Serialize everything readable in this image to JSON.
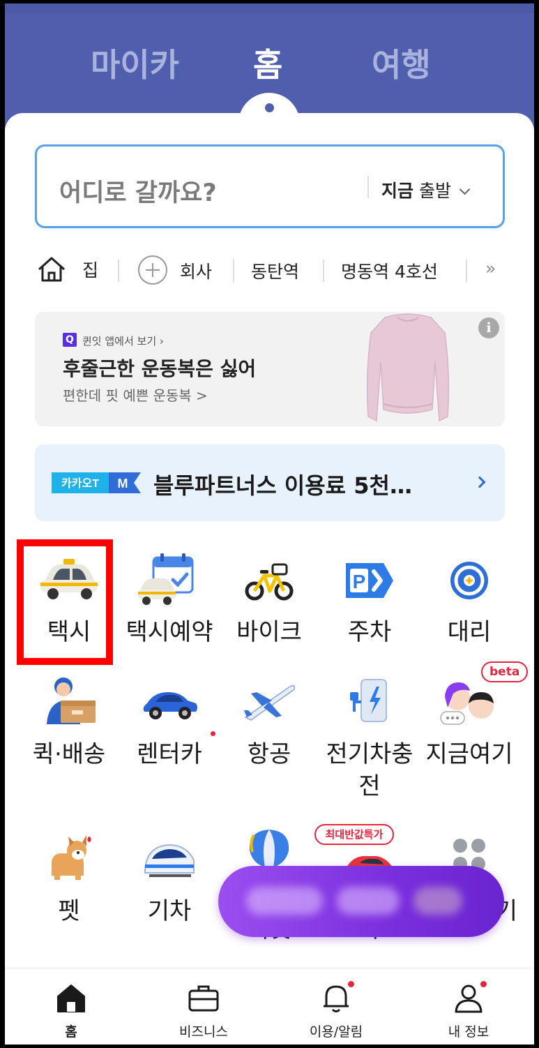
{
  "top_tabs": [
    {
      "label": "마이카",
      "active": false
    },
    {
      "label": "홈",
      "active": true
    },
    {
      "label": "여행",
      "active": false
    }
  ],
  "search": {
    "placeholder": "어디로 갈까요?",
    "depart_strong": "지금",
    "depart_rest": " 출발"
  },
  "shortcuts": [
    {
      "label": "집",
      "icon": "home-icon"
    },
    {
      "label": "회사",
      "icon": "plus-circle-icon"
    },
    {
      "label": "동탄역"
    },
    {
      "label": "명동역 4호선"
    }
  ],
  "more_glyph": "»",
  "ad": {
    "source": "퀸잇 앱에서 보기 ›",
    "source_logo": "Q",
    "title": "후줄근한 운동복은 싫어",
    "subtitle": "편한데 핏 예쁜 운동복 >",
    "info": "i"
  },
  "promo": {
    "badge_left": "카카오T",
    "badge_right": "M",
    "text": "블루파트너스 이용료 5천…"
  },
  "services": [
    {
      "label": "택시",
      "icon": "taxi-icon"
    },
    {
      "label": "택시예약",
      "icon": "taxi-reservation-icon"
    },
    {
      "label": "바이크",
      "icon": "bike-icon"
    },
    {
      "label": "주차",
      "icon": "parking-icon"
    },
    {
      "label": "대리",
      "icon": "steering-wheel-icon"
    },
    {
      "label": "퀵·배송",
      "icon": "delivery-icon"
    },
    {
      "label": "렌터카",
      "icon": "rental-car-icon",
      "dot": true
    },
    {
      "label": "항공",
      "icon": "airplane-icon"
    },
    {
      "label": "전기차충전",
      "icon": "ev-charging-icon"
    },
    {
      "label": "지금여기",
      "icon": "now-here-icon",
      "badge": "beta"
    },
    {
      "label": "펫",
      "icon": "pet-icon"
    },
    {
      "label": "기차",
      "icon": "train-icon"
    },
    {
      "label": "티켓",
      "icon": "balloon-icon"
    },
    {
      "label": "가",
      "icon": "sports-car-icon",
      "badge": "최대반값특가"
    },
    {
      "label": "기",
      "icon": "more-grid-icon"
    }
  ],
  "bottom_nav": [
    {
      "label": "홈",
      "icon": "home-filled-icon",
      "active": true
    },
    {
      "label": "비즈니스",
      "icon": "briefcase-icon"
    },
    {
      "label": "이용/알림",
      "icon": "bell-icon",
      "dot": true
    },
    {
      "label": "내 정보",
      "icon": "person-icon",
      "dot": true
    }
  ],
  "colors": {
    "header_bg": "#4f5fae",
    "search_border": "#5aa2e8",
    "highlight": "#ff0000",
    "accent_red": "#e8233c"
  }
}
